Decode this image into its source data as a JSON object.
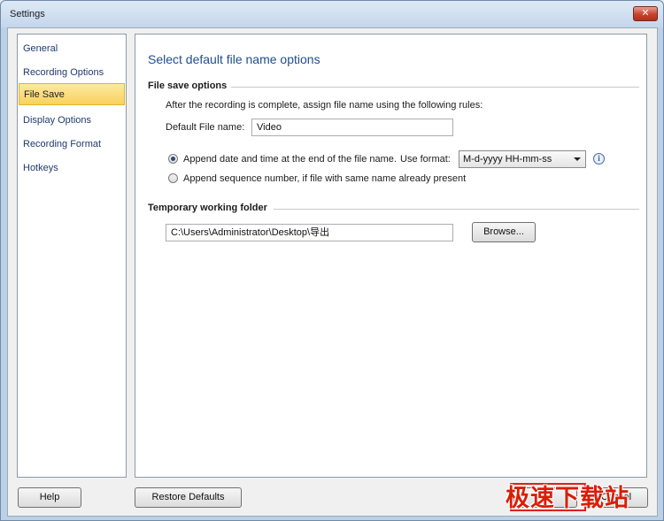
{
  "window": {
    "title": "Settings",
    "close_glyph": "✕"
  },
  "nav": {
    "items": [
      {
        "label": "General"
      },
      {
        "label": "Recording Options"
      },
      {
        "label": "File Save",
        "active": true
      },
      {
        "label": "Display Options"
      },
      {
        "label": "Recording Format"
      },
      {
        "label": "Hotkeys"
      }
    ]
  },
  "main": {
    "heading": "Select default file name options",
    "file_save": {
      "title": "File save options",
      "instruction": "After the recording is complete, assign file name using the following rules:",
      "default_name_label": "Default File name:",
      "default_name_value": "Video",
      "option_datetime": "Append date and time at the end of the file name.",
      "use_format_label": "Use format:",
      "format_value": "M-d-yyyy HH-mm-ss",
      "option_sequence": "Append sequence number, if file with same name already present",
      "selected_option": "datetime",
      "info_glyph": "i"
    },
    "temp_folder": {
      "title": "Temporary working folder",
      "path_value": "C:\\Users\\Administrator\\Desktop\\导出",
      "browse_label": "Browse..."
    }
  },
  "footer": {
    "help_label": "Help",
    "restore_label": "Restore Defaults",
    "ok_label": "OK",
    "cancel_label": "Cancel"
  },
  "watermark": {
    "text": "极速下载站"
  },
  "colors": {
    "accent": "#1f4e8c",
    "selection": "#f8d25c",
    "watermark": "#d81e06"
  }
}
